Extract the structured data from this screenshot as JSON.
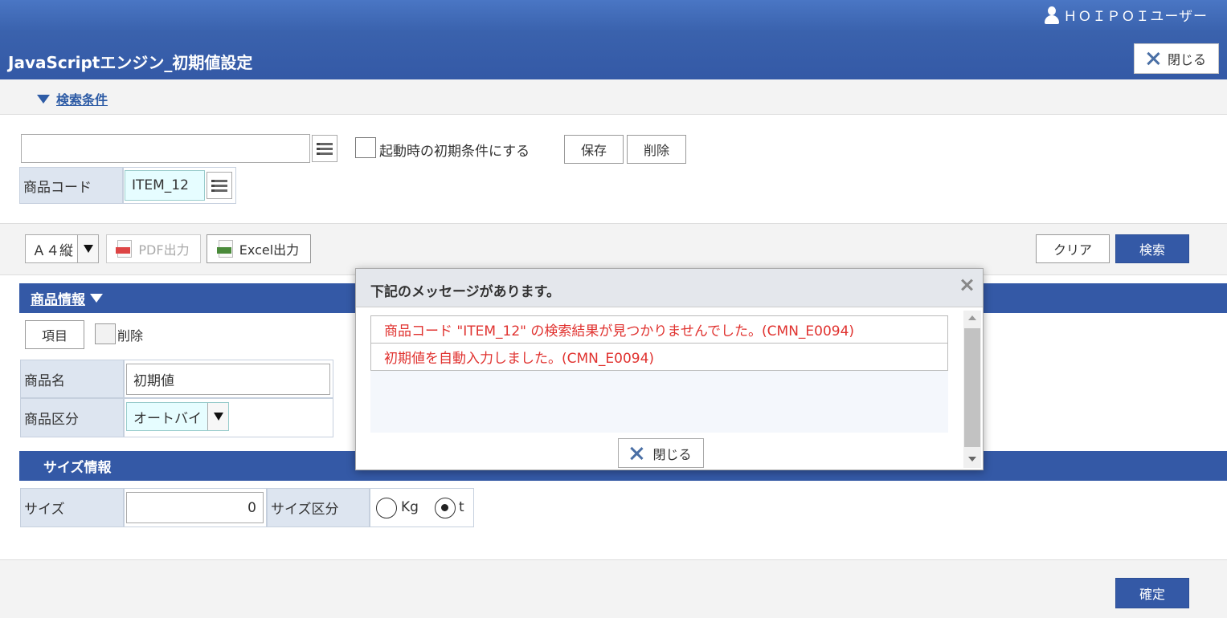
{
  "header": {
    "user_name": "ＨＯＩＰＯＩユーザー",
    "title": "JavaScriptエンジン_初期値設定",
    "close_label": "閉じる"
  },
  "search_conditions": {
    "toggle_label": "検索条件",
    "condition_name_value": "",
    "default_checkbox_label": "起動時の初期条件にする",
    "default_checked": false,
    "save_label": "保存",
    "delete_label": "削除",
    "item_code_label": "商品コード",
    "item_code_value": "ITEM_12"
  },
  "toolbar": {
    "paper_size": "Ａ４縦",
    "pdf_label": "PDF出力",
    "excel_label": "Excel出力",
    "clear_label": "クリア",
    "search_label": "検索"
  },
  "product_section": {
    "title": "商品情報",
    "item_button_label": "項目",
    "delete_checkbox_label": "削除",
    "delete_checked": false,
    "name_label": "商品名",
    "name_value": "初期値",
    "category_label": "商品区分",
    "category_value": "オートバイ"
  },
  "size_section": {
    "title": "サイズ情報",
    "size_label": "サイズ",
    "size_value": "0",
    "size_unit_label": "サイズ区分",
    "unit_options": [
      "Kg",
      "t"
    ],
    "unit_selected": "t"
  },
  "footer": {
    "confirm_label": "確定"
  },
  "dialog": {
    "title": "下記のメッセージがあります。",
    "messages": [
      "商品コード \"ITEM_12\" の検索結果が見つかりませんでした。(CMN_E0094)",
      "初期値を自動入力しました。(CMN_E0094)"
    ],
    "close_label": "閉じる"
  },
  "colors": {
    "header_blue": "#3459a6",
    "label_bg": "#dde5f0",
    "error_red": "#e0322f",
    "input_cyan": "#e6fdff"
  }
}
